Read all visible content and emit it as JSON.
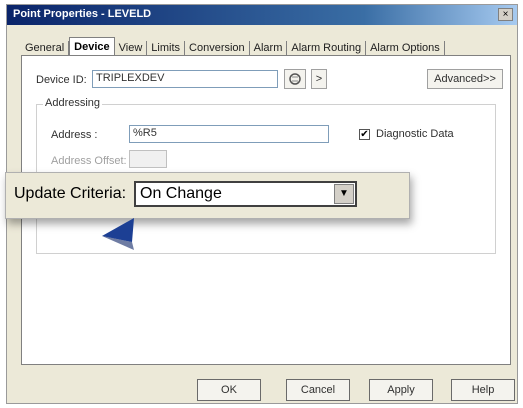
{
  "window": {
    "title": "Point Properties - LEVELD",
    "close_label": "×"
  },
  "tabs": [
    {
      "label": "General",
      "active": false
    },
    {
      "label": "Device",
      "active": true
    },
    {
      "label": "View",
      "active": false
    },
    {
      "label": "Limits",
      "active": false
    },
    {
      "label": "Conversion",
      "active": false
    },
    {
      "label": "Alarm",
      "active": false
    },
    {
      "label": "Alarm Routing",
      "active": false
    },
    {
      "label": "Alarm Options",
      "active": false
    }
  ],
  "device": {
    "device_id_label": "Device ID:",
    "device_id_value": "TRIPLEXDEV",
    "next_label": ">",
    "advanced_label": "Advanced>>"
  },
  "addressing": {
    "group_title": "Addressing",
    "address_label": "Address :",
    "address_value": "%R5",
    "address_offset_label": "Address Offset:",
    "diagnostic_label": "Diagnostic Data",
    "diagnostic_checked": true
  },
  "update": {
    "label": "Update Criteria:",
    "value": "On Change",
    "dropdown_icon": "▼"
  },
  "buttons": {
    "ok": "OK",
    "cancel": "Cancel",
    "apply": "Apply",
    "help": "Help"
  },
  "colors": {
    "title_bar": "#0a246a",
    "dialog_bg": "#ece9d8",
    "pointer": "#1c3f94"
  }
}
